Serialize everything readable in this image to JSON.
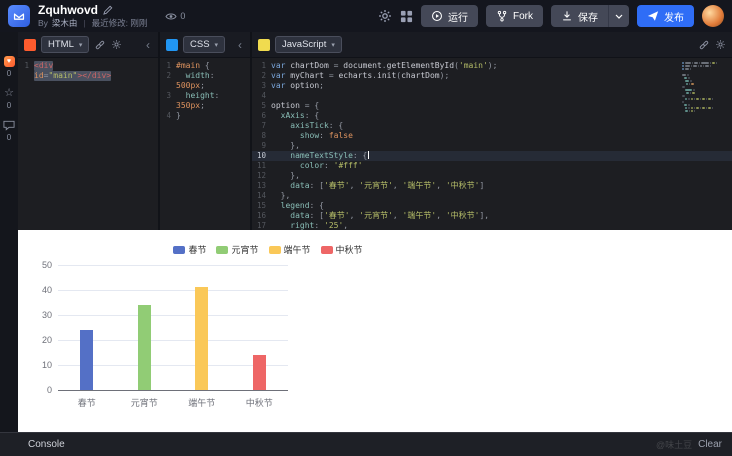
{
  "header": {
    "title": "Zquhwovd",
    "byline": {
      "prefix": "By",
      "author": "梁木由",
      "separator": "|",
      "modified": "最近修改: 刚刚"
    },
    "views": "0",
    "actions": {
      "run": "运行",
      "fork": "Fork",
      "save": "保存",
      "publish": "发布"
    }
  },
  "rail": {
    "counts": [
      "0",
      "0",
      "0"
    ]
  },
  "panes": {
    "html": {
      "label": "HTML",
      "rows": [
        {
          "n": "1",
          "sel": true,
          "t": [
            [
              "t",
              "<div"
            ]
          ]
        },
        {
          "n": "",
          "sel": true,
          "t": [
            [
              "a",
              "id"
            ],
            [
              "u",
              "="
            ],
            [
              "s",
              "\"main\""
            ],
            [
              "t",
              "></div>"
            ]
          ]
        }
      ]
    },
    "css": {
      "label": "CSS",
      "rows": [
        {
          "n": "1",
          "t": [
            [
              "a",
              "#main"
            ],
            [
              "u",
              " {"
            ]
          ]
        },
        {
          "n": "2",
          "t": [
            [
              "d",
              "  "
            ],
            [
              "pr",
              "width"
            ],
            [
              "u",
              ":"
            ]
          ]
        },
        {
          "n": "",
          "t": [
            [
              "num",
              "500px"
            ],
            [
              "u",
              ";"
            ]
          ]
        },
        {
          "n": "3",
          "t": [
            [
              "d",
              "  "
            ],
            [
              "pr",
              "height"
            ],
            [
              "u",
              ":"
            ]
          ]
        },
        {
          "n": "",
          "t": [
            [
              "num",
              "350px"
            ],
            [
              "u",
              ";"
            ]
          ]
        },
        {
          "n": "4",
          "t": [
            [
              "u",
              "}"
            ]
          ]
        }
      ]
    },
    "js": {
      "label": "JavaScript",
      "rows": [
        {
          "n": "1",
          "t": [
            [
              "k",
              "var"
            ],
            [
              "d",
              " chartDom "
            ],
            [
              "u",
              "= "
            ],
            [
              "d",
              "document"
            ],
            [
              "u",
              "."
            ],
            [
              "d",
              "getElementById"
            ],
            [
              "u",
              "("
            ],
            [
              "s",
              "'main'"
            ],
            [
              "u",
              ");"
            ]
          ]
        },
        {
          "n": "2",
          "t": [
            [
              "k",
              "var"
            ],
            [
              "d",
              " myChart "
            ],
            [
              "u",
              "= "
            ],
            [
              "d",
              "echarts"
            ],
            [
              "u",
              "."
            ],
            [
              "d",
              "init"
            ],
            [
              "u",
              "("
            ],
            [
              "d",
              "chartDom"
            ],
            [
              "u",
              ");"
            ]
          ]
        },
        {
          "n": "3",
          "t": [
            [
              "k",
              "var"
            ],
            [
              "d",
              " option"
            ],
            [
              "u",
              ";"
            ]
          ]
        },
        {
          "n": "4",
          "t": []
        },
        {
          "n": "5",
          "t": [
            [
              "d",
              "option "
            ],
            [
              "u",
              "= {"
            ]
          ]
        },
        {
          "n": "6",
          "t": [
            [
              "d",
              "  "
            ],
            [
              "pr",
              "xAxis"
            ],
            [
              "u",
              ": {"
            ]
          ]
        },
        {
          "n": "7",
          "t": [
            [
              "d",
              "    "
            ],
            [
              "pr",
              "axisTick"
            ],
            [
              "u",
              ": {"
            ]
          ]
        },
        {
          "n": "8",
          "t": [
            [
              "d",
              "      "
            ],
            [
              "pr",
              "show"
            ],
            [
              "u",
              ": "
            ],
            [
              "num",
              "false"
            ]
          ]
        },
        {
          "n": "9",
          "t": [
            [
              "u",
              "    },"
            ]
          ]
        },
        {
          "n": "10",
          "active": true,
          "cursor": true,
          "t": [
            [
              "d",
              "    "
            ],
            [
              "pr",
              "nameTextStyle"
            ],
            [
              "u",
              ": {"
            ]
          ]
        },
        {
          "n": "11",
          "t": [
            [
              "d",
              "      "
            ],
            [
              "pr",
              "color"
            ],
            [
              "u",
              ": "
            ],
            [
              "s",
              "'#fff'"
            ]
          ]
        },
        {
          "n": "12",
          "t": [
            [
              "u",
              "    },"
            ]
          ]
        },
        {
          "n": "13",
          "t": [
            [
              "d",
              "    "
            ],
            [
              "pr",
              "data"
            ],
            [
              "u",
              ": ["
            ],
            [
              "s",
              "'春节'"
            ],
            [
              "u",
              ", "
            ],
            [
              "s",
              "'元宵节'"
            ],
            [
              "u",
              ", "
            ],
            [
              "s",
              "'端午节'"
            ],
            [
              "u",
              ", "
            ],
            [
              "s",
              "'中秋节'"
            ],
            [
              "u",
              "]"
            ]
          ]
        },
        {
          "n": "14",
          "t": [
            [
              "u",
              "  },"
            ]
          ]
        },
        {
          "n": "15",
          "t": [
            [
              "d",
              "  "
            ],
            [
              "pr",
              "legend"
            ],
            [
              "u",
              ": {"
            ]
          ]
        },
        {
          "n": "16",
          "t": [
            [
              "d",
              "    "
            ],
            [
              "pr",
              "data"
            ],
            [
              "u",
              ": ["
            ],
            [
              "s",
              "'春节'"
            ],
            [
              "u",
              ", "
            ],
            [
              "s",
              "'元宵节'"
            ],
            [
              "u",
              ", "
            ],
            [
              "s",
              "'端午节'"
            ],
            [
              "u",
              ", "
            ],
            [
              "s",
              "'中秋节'"
            ],
            [
              "u",
              "],"
            ]
          ]
        },
        {
          "n": "17",
          "t": [
            [
              "d",
              "    "
            ],
            [
              "pr",
              "right"
            ],
            [
              "u",
              ": "
            ],
            [
              "s",
              "'25'"
            ],
            [
              "u",
              ","
            ]
          ]
        }
      ]
    }
  },
  "console": {
    "label": "Console",
    "clear": "Clear",
    "watermark": "@味土豆"
  },
  "chart_data": {
    "type": "bar",
    "title": "",
    "xlabel": "",
    "ylabel": "",
    "categories": [
      "春节",
      "元宵节",
      "端午节",
      "中秋节"
    ],
    "values": [
      24,
      34,
      41,
      14
    ],
    "colors": [
      "#5470c6",
      "#91cc75",
      "#fac858",
      "#ee6666"
    ],
    "legend": [
      "春节",
      "元宵节",
      "端午节",
      "中秋节"
    ],
    "legend_position": "top-center",
    "ylim": [
      0,
      50
    ],
    "yticks": [
      0,
      10,
      20,
      30,
      40,
      50
    ],
    "grid": true
  }
}
